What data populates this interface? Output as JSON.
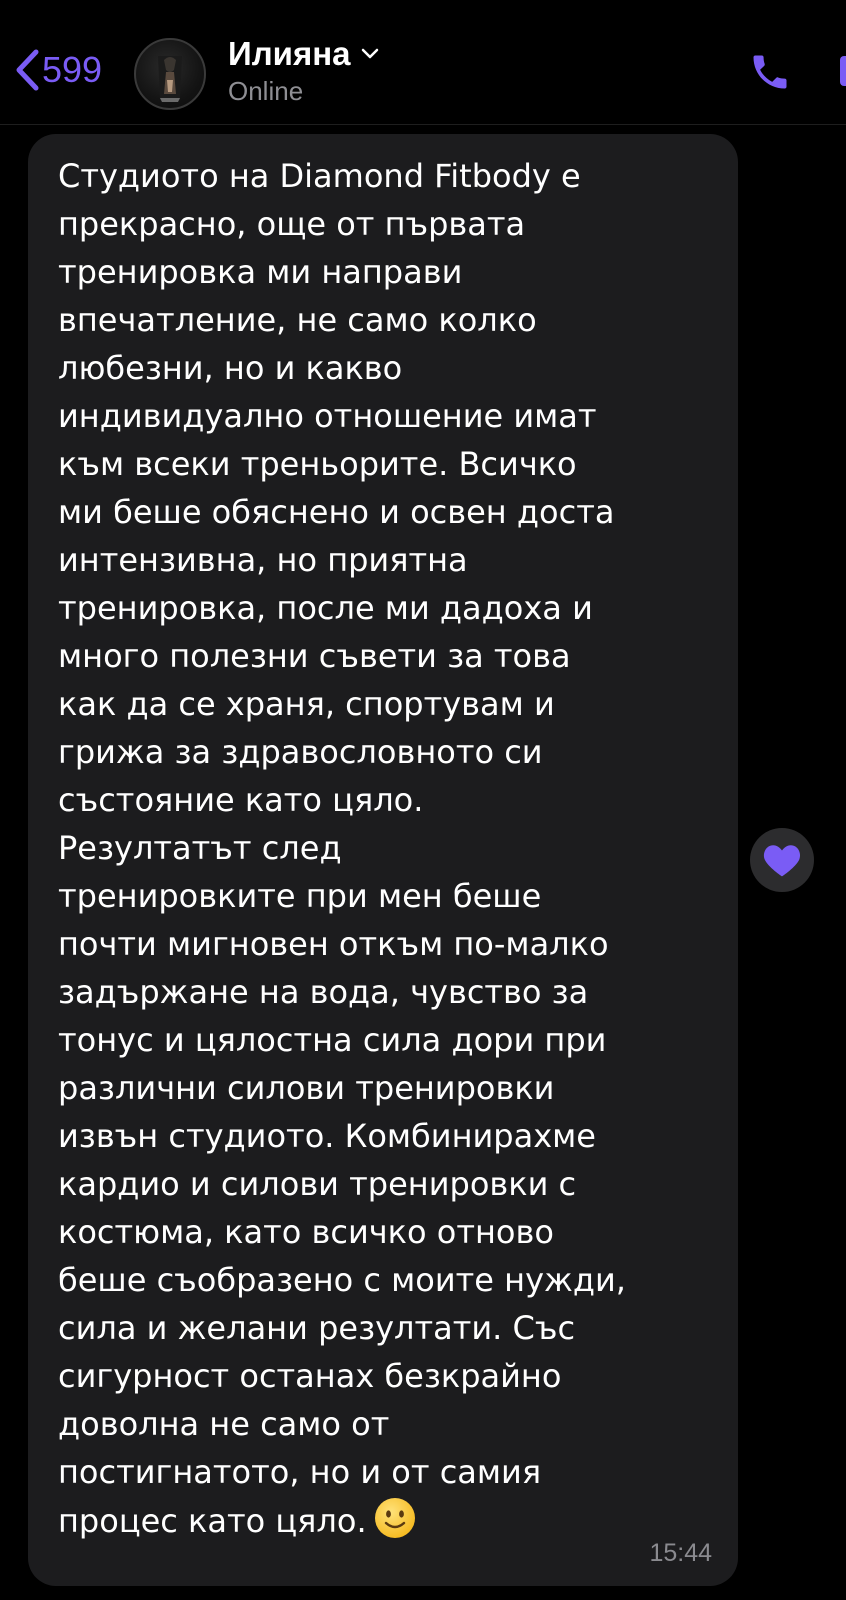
{
  "colors": {
    "accent": "#7a5cf5",
    "background": "#000000",
    "bubble": "#1c1c1e",
    "secondary_text": "#8e8e93"
  },
  "header": {
    "back_count": "599",
    "back_icon": "chevron-left-icon",
    "contact_name": "Илияна",
    "status": "Online",
    "call_icon": "phone-icon"
  },
  "message": {
    "text": "Студиото на Diamond Fitbody е\nпрекрасно, още от първата\nтренировка ми направи\nвпечатление, не само колко\nлюбезни, но и какво\nиндивидуално отношение имат\nкъм всеки треньорите. Всичко\nми беше обяснено и освен доста\nинтензивна, но приятна\nтренировка, после ми дадоха и\nмного полезни съвети за това\nкак да се храня, спортувам и\nгрижа за здравословното си\nсъстояние като цяло.\nРезултатът след\nтренировките при мен беше\nпочти мигновен откъм по-малко\nзадържане на вода, чувство за\nтонус и цялостна сила дори при\nразлични силови тренировки\nизвън студиото. Комбинирахме\nкардио и силови тренировки с\nкостюма, като всичко отново\nбеше съобразено с моите нужди,\nсила и желани резултати. Със\nсигурност останах безкрайно\nдоволна не само от\nпостигнатото, но и от самия\nпроцес като цяло.",
    "emoji": "slightly-smiling-face-icon",
    "time": "15:44",
    "reaction": "heart-icon"
  }
}
